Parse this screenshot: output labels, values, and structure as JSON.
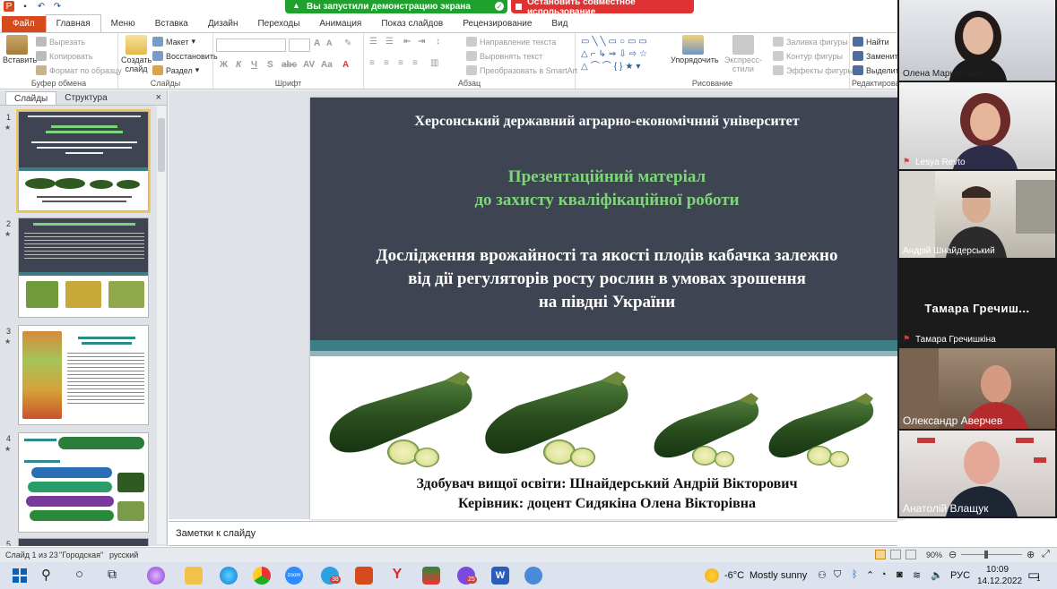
{
  "share_bar": {
    "share_status": "Вы запустили демонстрацию экрана",
    "stop_share": "Остановить совместное использование",
    "colors": {
      "share": "#1fa12e",
      "stop": "#e03232"
    }
  },
  "ribbon": {
    "tabs": [
      "Файл",
      "Главная",
      "Меню",
      "Вставка",
      "Дизайн",
      "Переходы",
      "Анимация",
      "Показ слайдов",
      "Рецензирование",
      "Вид"
    ],
    "active_tab": "Главная",
    "clipboard": {
      "paste": "Вставить",
      "cut": "Вырезать",
      "copy": "Копировать",
      "format_painter": "Формат по образцу",
      "label": "Буфер обмена"
    },
    "slides": {
      "new_slide": "Создать слайд",
      "layout": "Макет",
      "reset": "Восстановить",
      "section": "Раздел",
      "label": "Слайды"
    },
    "font": {
      "label": "Шрифт"
    },
    "paragraph": {
      "text_direction": "Направление текста",
      "align_text": "Выровнять текст",
      "smartart": "Преобразовать в SmartArt",
      "label": "Абзац"
    },
    "drawing": {
      "arrange": "Упорядочить",
      "quick_styles": "Экспресс-стили",
      "shape_fill": "Заливка фигуры",
      "shape_outline": "Контур фигуры",
      "shape_effects": "Эффекты фигуры",
      "label": "Рисование"
    },
    "editing": {
      "find": "Найти",
      "replace": "Заменить",
      "select": "Выделить",
      "label": "Редактирован"
    }
  },
  "panel": {
    "tabs": [
      "Слайды",
      "Структура"
    ],
    "close": "×",
    "thumbnails": [
      {
        "number": "1"
      },
      {
        "number": "2"
      },
      {
        "number": "3"
      },
      {
        "number": "4"
      },
      {
        "number": "5"
      }
    ]
  },
  "slide": {
    "university": "Херсонський державний аграрно-економічний університет",
    "presentation_title_1": "Презентаційний матеріал",
    "presentation_title_2": "до захисту кваліфікаційної роботи",
    "study_title_1": "Дослідження врожайності та якості плодів кабачка залежно",
    "study_title_2": "від дії регуляторів росту рослин в умовах зрошення",
    "study_title_3": "на півдні України",
    "author": "Здобувач вищої освіти: Шнайдерський Андрій Вікторович",
    "supervisor": "Керівник: доцент Сидякіна Олена Вікторівна",
    "colors": {
      "dark": "#3f4453",
      "green_title": "#7fd67a",
      "teal": "#3e7d85"
    }
  },
  "notes": {
    "placeholder": "Заметки к слайду"
  },
  "status": {
    "slide_info": "Слайд 1 из 23",
    "theme": "\"Городская\"",
    "language": "русский",
    "zoom": "90%"
  },
  "taskbar": {
    "weather_temp": "-6°C",
    "weather_text": "Mostly sunny",
    "lang": "РУС",
    "time": "10:09",
    "date": "14.12.2022",
    "badge_yandex": "38",
    "badge_viber": "25",
    "notifications": "1"
  },
  "participants": [
    {
      "name": "Олена Марковська"
    },
    {
      "name": "Lesya Revto"
    },
    {
      "name": "Андрій Шнайдерський"
    },
    {
      "name": "Тамара Гречишкіна",
      "display": "Тамара  Гречиш..."
    },
    {
      "name": "Олександр Аверчев"
    },
    {
      "name": "Анатолій  Влащук"
    }
  ]
}
